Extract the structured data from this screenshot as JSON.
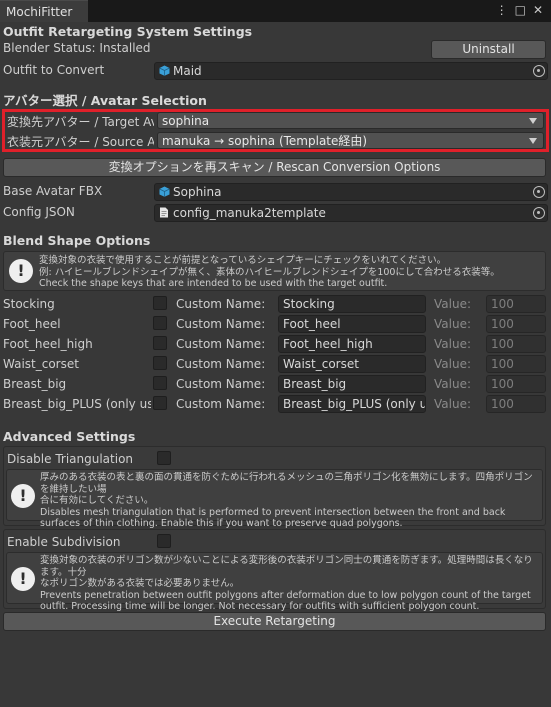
{
  "window": {
    "title": "MochiFitter",
    "icons": [
      "more-icon",
      "maximize-icon",
      "close-icon"
    ]
  },
  "settings": {
    "header": "Outfit Retargeting System Settings",
    "blender_status": "Blender Status: Installed",
    "uninstall_label": "Uninstall",
    "outfit_label": "Outfit to Convert",
    "outfit_value": "Maid"
  },
  "avatar": {
    "header": "アバター選択 / Avatar Selection",
    "target_label": "変換先アバター / Target Avat",
    "target_value": "sophina",
    "source_label": "衣装元アバター / Source Ava",
    "source_value": "manuka → sophina (Template経由)",
    "rescan_label": "変換オプションを再スキャン / Rescan Conversion Options",
    "base_fbx_label": "Base Avatar FBX",
    "base_fbx_value": "Sophina",
    "config_label": "Config JSON",
    "config_value": "config_manuka2template"
  },
  "blend": {
    "header": "Blend Shape Options",
    "help_line1": "変換対象の衣装で使用することが前提となっているシェイプキーにチェックをいれてください。",
    "help_line2": "例: ハイヒールブレンドシェイプが無く、素体のハイヒールブレンドシェイプを100にして合わせる衣装等。",
    "help_line3": "Check the shape keys that are intended to be used with the target outfit.",
    "custom_name_label": "Custom Name:",
    "value_label": "Value:",
    "rows": [
      {
        "name": "Stocking",
        "custom": "Stocking",
        "value": "100"
      },
      {
        "name": "Foot_heel",
        "custom": "Foot_heel",
        "value": "100"
      },
      {
        "name": "Foot_heel_high",
        "custom": "Foot_heel_high",
        "value": "100"
      },
      {
        "name": "Waist_corset",
        "custom": "Waist_corset",
        "value": "100"
      },
      {
        "name": "Breast_big",
        "custom": "Breast_big",
        "value": "100"
      },
      {
        "name": "Breast_big_PLUS (only use",
        "custom": "Breast_big_PLUS (only use",
        "value": "100"
      }
    ]
  },
  "advanced": {
    "header": "Advanced Settings",
    "tri_label": "Disable Triangulation",
    "tri_help1": "厚みのある衣装の表と裏の面の貫通を防ぐために行われるメッシュの三角ポリゴン化を無効にします。四角ポリゴンを維持したい場",
    "tri_help2": "合に有効にしてください。",
    "tri_help3": "Disables mesh triangulation that is performed to prevent intersection between the front and back",
    "tri_help4": "surfaces of thin clothing. Enable this if you want to preserve quad polygons.",
    "sub_label": "Enable Subdivision",
    "sub_help1": "変換対象の衣装のポリゴン数が少ないことによる変形後の衣装ポリゴン同士の貫通を防ぎます。処理時間は長くなります。十分",
    "sub_help2": "なポリゴン数がある衣装では必要ありません。",
    "sub_help3": "Prevents penetration between outfit polygons after deformation due to low polygon count of the target",
    "sub_help4": "outfit. Processing time will be longer. Not necessary for outfits with sufficient polygon count.",
    "execute_label": "Execute Retargeting"
  }
}
